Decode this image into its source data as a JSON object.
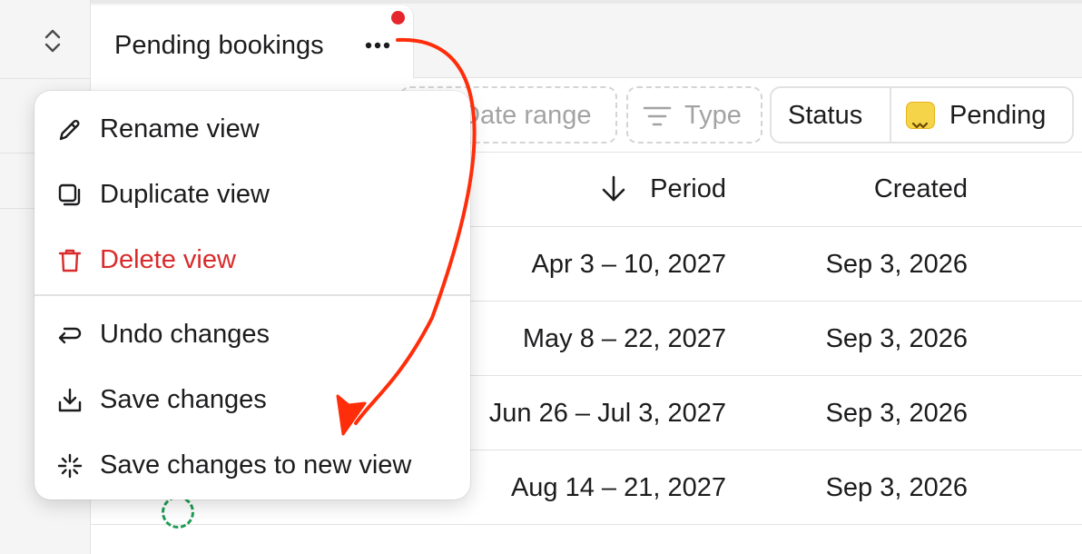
{
  "tab": {
    "title": "Pending bookings",
    "unsaved_indicator_color": "#e5242b"
  },
  "filters": {
    "date_range": "Date range",
    "type": "Type",
    "status_label": "Status",
    "status_value": "Pending",
    "status_icon": "pending-icon"
  },
  "table": {
    "columns": {
      "period": "Period",
      "created": "Created"
    },
    "sort": {
      "column": "period",
      "direction": "desc",
      "icon": "arrow-down-icon"
    },
    "rows": [
      {
        "period": "Apr 3 – 10, 2027",
        "created": "Sep 3, 2026"
      },
      {
        "period": "May 8 – 22, 2027",
        "created": "Sep 3, 2026"
      },
      {
        "period": "Jun 26 – Jul 3, 2027",
        "created": "Sep 3, 2026"
      },
      {
        "period": "Aug 14 – 21, 2027",
        "created": "Sep 3, 2026"
      }
    ]
  },
  "menu": {
    "items": [
      {
        "label": "Rename view",
        "icon": "pencil-icon"
      },
      {
        "label": "Duplicate view",
        "icon": "duplicate-icon"
      },
      {
        "label": "Delete view",
        "icon": "trash-icon",
        "danger": true
      },
      {
        "label": "Undo changes",
        "icon": "undo-icon"
      },
      {
        "label": "Save changes",
        "icon": "download-icon"
      },
      {
        "label": "Save changes to new view",
        "icon": "sparkle-icon"
      }
    ]
  },
  "colors": {
    "danger": "#d92b2b",
    "annotation_arrow": "#ff2d0a",
    "pending_badge": "#f6d44a"
  }
}
